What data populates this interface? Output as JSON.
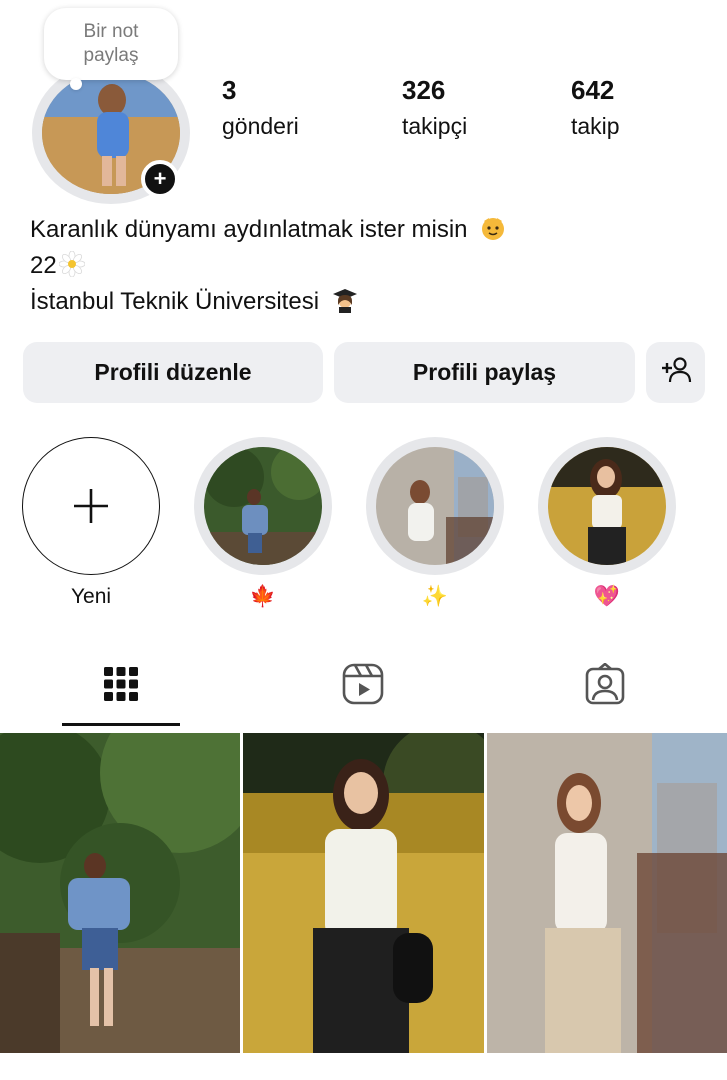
{
  "note": {
    "text_line1": "Bir not",
    "text_line2": "paylaş"
  },
  "stats": {
    "posts": {
      "count": "3",
      "label": "gönderi"
    },
    "followers": {
      "count": "326",
      "label": "takipçi"
    },
    "following": {
      "count": "642",
      "label": "takip"
    }
  },
  "bio": {
    "line1": "Karanlık dünyamı aydınlatmak ister misin",
    "line2": "22",
    "line3": "İstanbul Teknik Üniversitesi"
  },
  "buttons": {
    "edit_profile": "Profili düzenle",
    "share_profile": "Profili paylaş",
    "add_person_icon": "add-person-icon"
  },
  "highlights": [
    {
      "label": "Yeni",
      "icon": "plus-icon"
    },
    {
      "label": "🍁"
    },
    {
      "label": "✨"
    },
    {
      "label": "💖"
    }
  ],
  "tabs": [
    {
      "icon": "grid-icon",
      "active": true
    },
    {
      "icon": "reels-icon",
      "active": false
    },
    {
      "icon": "tagged-icon",
      "active": false
    }
  ],
  "colors": {
    "button_bg": "#eeeff2",
    "ring": "#e6e7ea",
    "text": "#111111"
  }
}
